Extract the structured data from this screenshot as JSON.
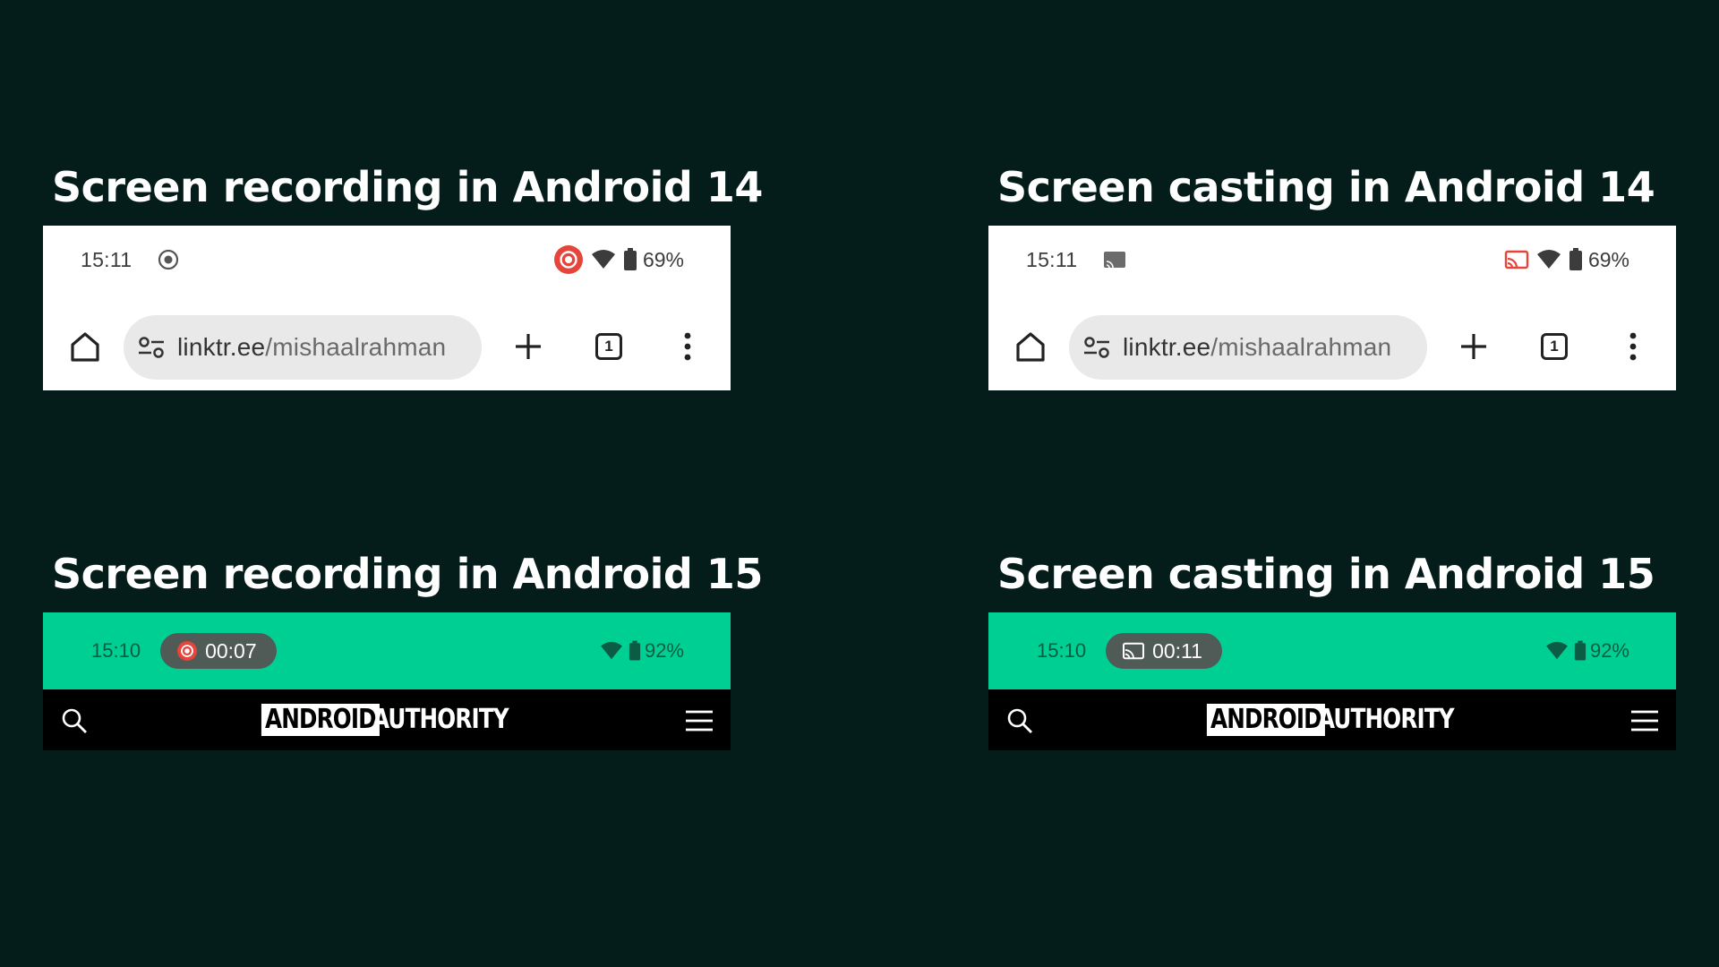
{
  "panels": {
    "rec14": {
      "title": "Screen recording in Android 14",
      "status_time": "15:11",
      "battery": "69%",
      "url_prefix": "linktr.ee",
      "url_path": "/mishaalrahman",
      "tab_count": "1"
    },
    "cast14": {
      "title": "Screen casting in Android 14",
      "status_time": "15:11",
      "battery": "69%",
      "url_prefix": "linktr.ee",
      "url_path": "/mishaalrahman",
      "tab_count": "1"
    },
    "rec15": {
      "title": "Screen recording in Android 15",
      "status_time": "15:10",
      "chip_timer": "00:07",
      "battery": "92%",
      "logo_left": "ANDROID",
      "logo_right": "AUTHORITY"
    },
    "cast15": {
      "title": "Screen casting in Android 15",
      "status_time": "15:10",
      "chip_timer": "00:11",
      "battery": "92%",
      "logo_left": "ANDROID",
      "logo_right": "AUTHORITY"
    }
  },
  "colors": {
    "background": "#041d1a",
    "accent_green": "#00cf94",
    "recording_red": "#e5453a",
    "chip_gray": "#505a56"
  },
  "icons": [
    "home-icon",
    "tune-icon",
    "plus-icon",
    "tab-switcher-icon",
    "more-vert-icon",
    "wifi-icon",
    "battery-icon",
    "record-icon",
    "cast-icon",
    "search-icon",
    "menu-icon"
  ]
}
